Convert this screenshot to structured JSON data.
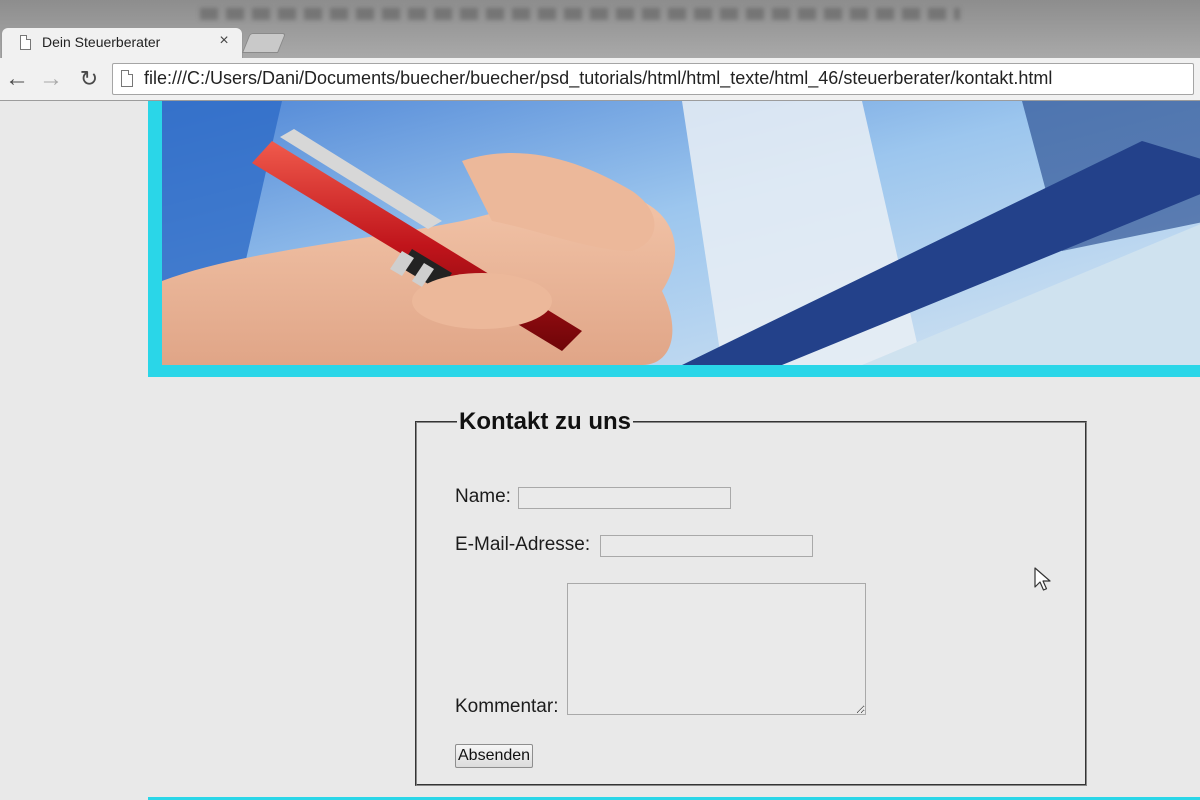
{
  "browser": {
    "tab": {
      "title": "Dein Steuerberater",
      "close_glyph": "×"
    },
    "nav": {
      "back_glyph": "←",
      "forward_glyph": "→",
      "reload_glyph": "↻"
    },
    "address_bar": {
      "url": "file:///C:/Users/Dani/Documents/buecher/buecher/psd_tutorials/html/html_texte/html_46/steuerberater/kontakt.html"
    }
  },
  "page": {
    "hero": {
      "image": "hand-holding-red-pen-photo",
      "accent_color": "#2ad6e8"
    },
    "form": {
      "legend": "Kontakt zu uns",
      "fields": {
        "name": {
          "label": "Name:",
          "value": ""
        },
        "email": {
          "label": "E-Mail-Adresse:",
          "value": ""
        },
        "comment": {
          "label": "Kommentar:",
          "value": ""
        }
      },
      "submit_label": "Absenden"
    }
  },
  "icons": {
    "tab": "page-icon",
    "address_bar": "page-icon",
    "cursor": "mouse-pointer-icon"
  }
}
